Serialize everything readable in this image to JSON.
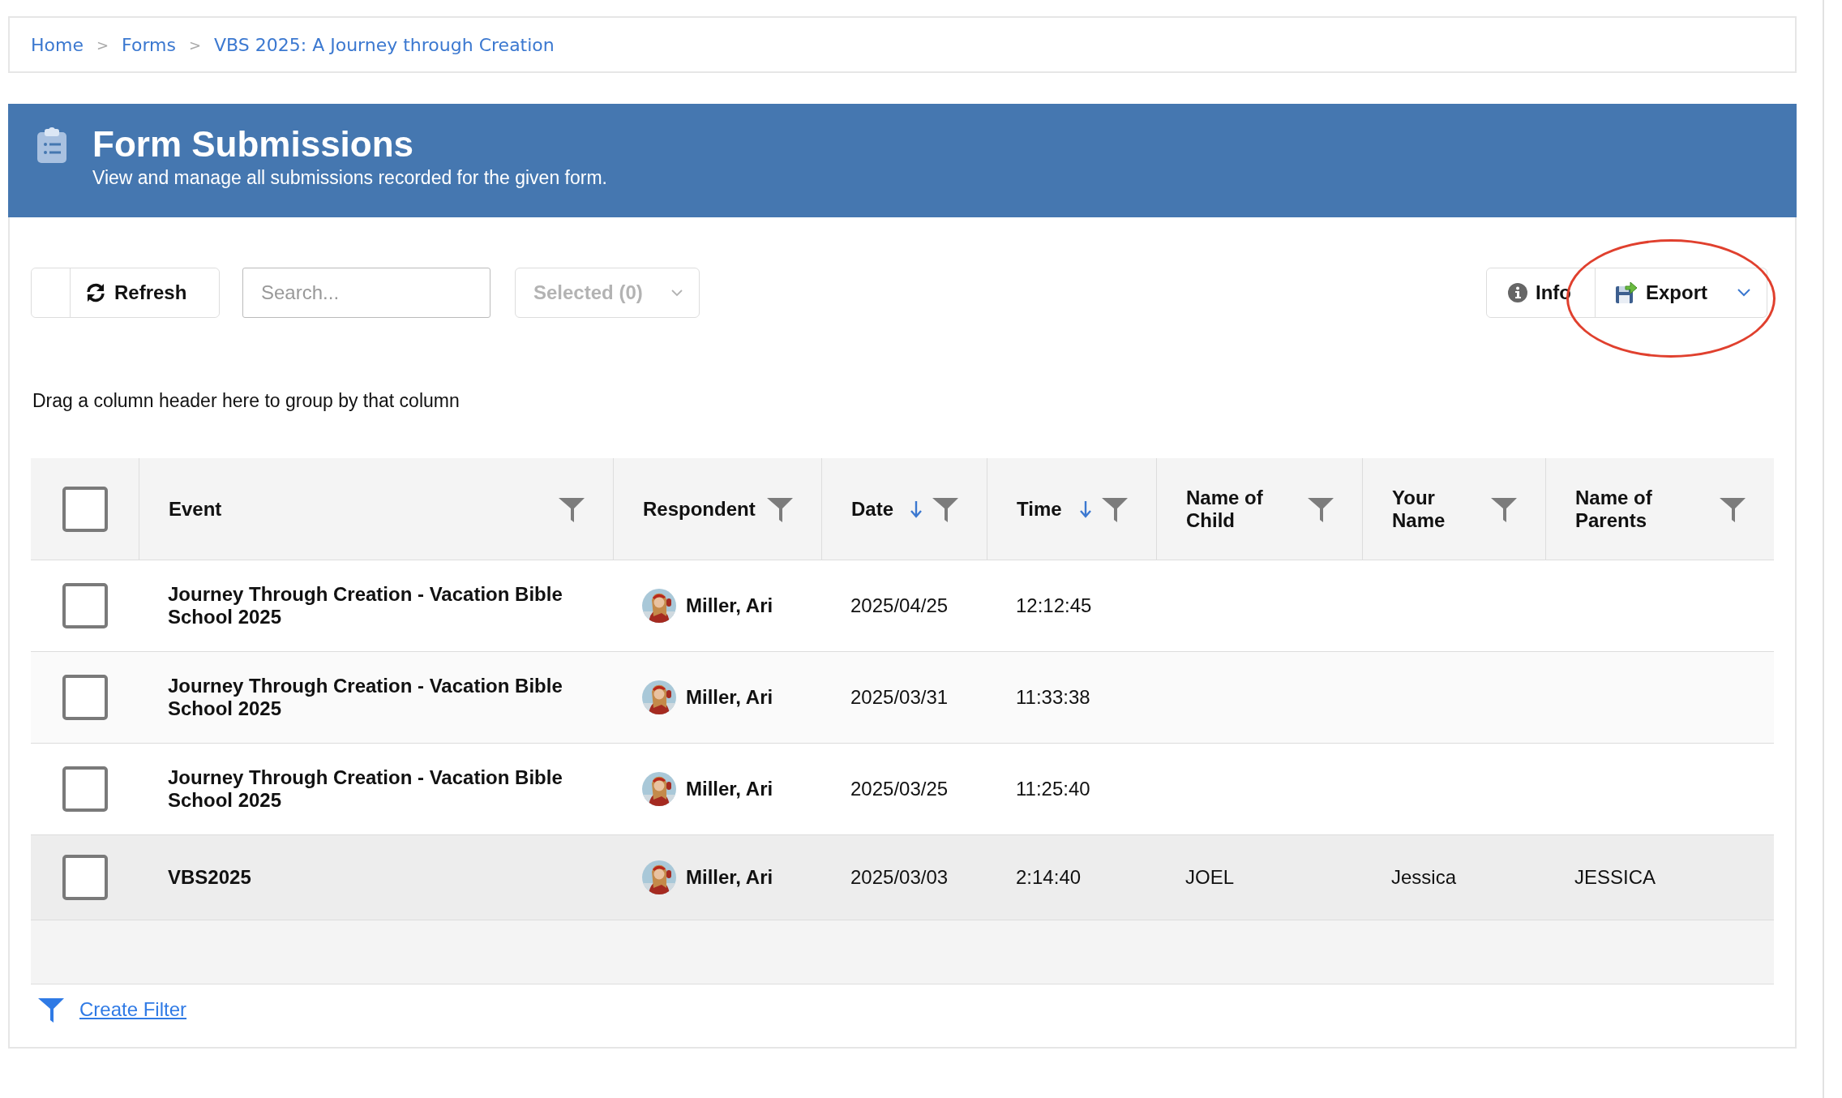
{
  "breadcrumb": [
    {
      "kind": "link",
      "label": "Home"
    },
    {
      "kind": "separator",
      "label": ">"
    },
    {
      "kind": "link",
      "label": "Forms"
    },
    {
      "kind": "separator",
      "label": ">"
    },
    {
      "kind": "link",
      "label": "VBS 2025: A Journey through Creation"
    }
  ],
  "header": {
    "title": "Form Submissions",
    "subtitle": "View and manage all submissions recorded for the given form."
  },
  "toolbar": {
    "refresh": "Refresh",
    "search": {
      "placeholder": "Search..."
    },
    "selection_menu": {
      "label": "Selected (0)",
      "disabled": true
    },
    "info": "Info",
    "export": "Export"
  },
  "group_hint": "Drag a column header here to group by that column",
  "table": {
    "all_checked": false,
    "columns": [
      {
        "label": "Event",
        "sorted_descending": false
      },
      {
        "label": "Respondent",
        "sorted_descending": false
      },
      {
        "label": "Date",
        "sorted_descending": true
      },
      {
        "label": "Time",
        "sorted_descending": true
      },
      {
        "label": "Name of Child",
        "sorted_descending": false
      },
      {
        "label": "Your Name",
        "sorted_descending": false
      },
      {
        "label": "Name of Parents",
        "sorted_descending": false
      }
    ],
    "rows": [
      {
        "selected": false,
        "checked": false,
        "event": "Journey Through Creation - Vacation Bible School 2025",
        "respondent": "Miller, Ari",
        "date": "2025/04/25",
        "time": "12:12:45"
      },
      {
        "selected": false,
        "checked": false,
        "event": "Journey Through Creation - Vacation Bible School 2025",
        "respondent": "Miller, Ari",
        "date": "2025/03/31",
        "time": "11:33:38"
      },
      {
        "selected": false,
        "checked": false,
        "event": "Journey Through Creation - Vacation Bible School 2025",
        "respondent": "Miller, Ari",
        "date": "2025/03/25",
        "time": "11:25:40"
      },
      {
        "selected": true,
        "checked": false,
        "event": "VBS2025",
        "respondent": "Miller, Ari",
        "date": "2025/03/03",
        "time": "2:14:40",
        "name_of_child": "JOEL",
        "your_name": "Jessica",
        "name_of_parents": "JESSICA"
      }
    ]
  },
  "create_filter": "Create Filter"
}
